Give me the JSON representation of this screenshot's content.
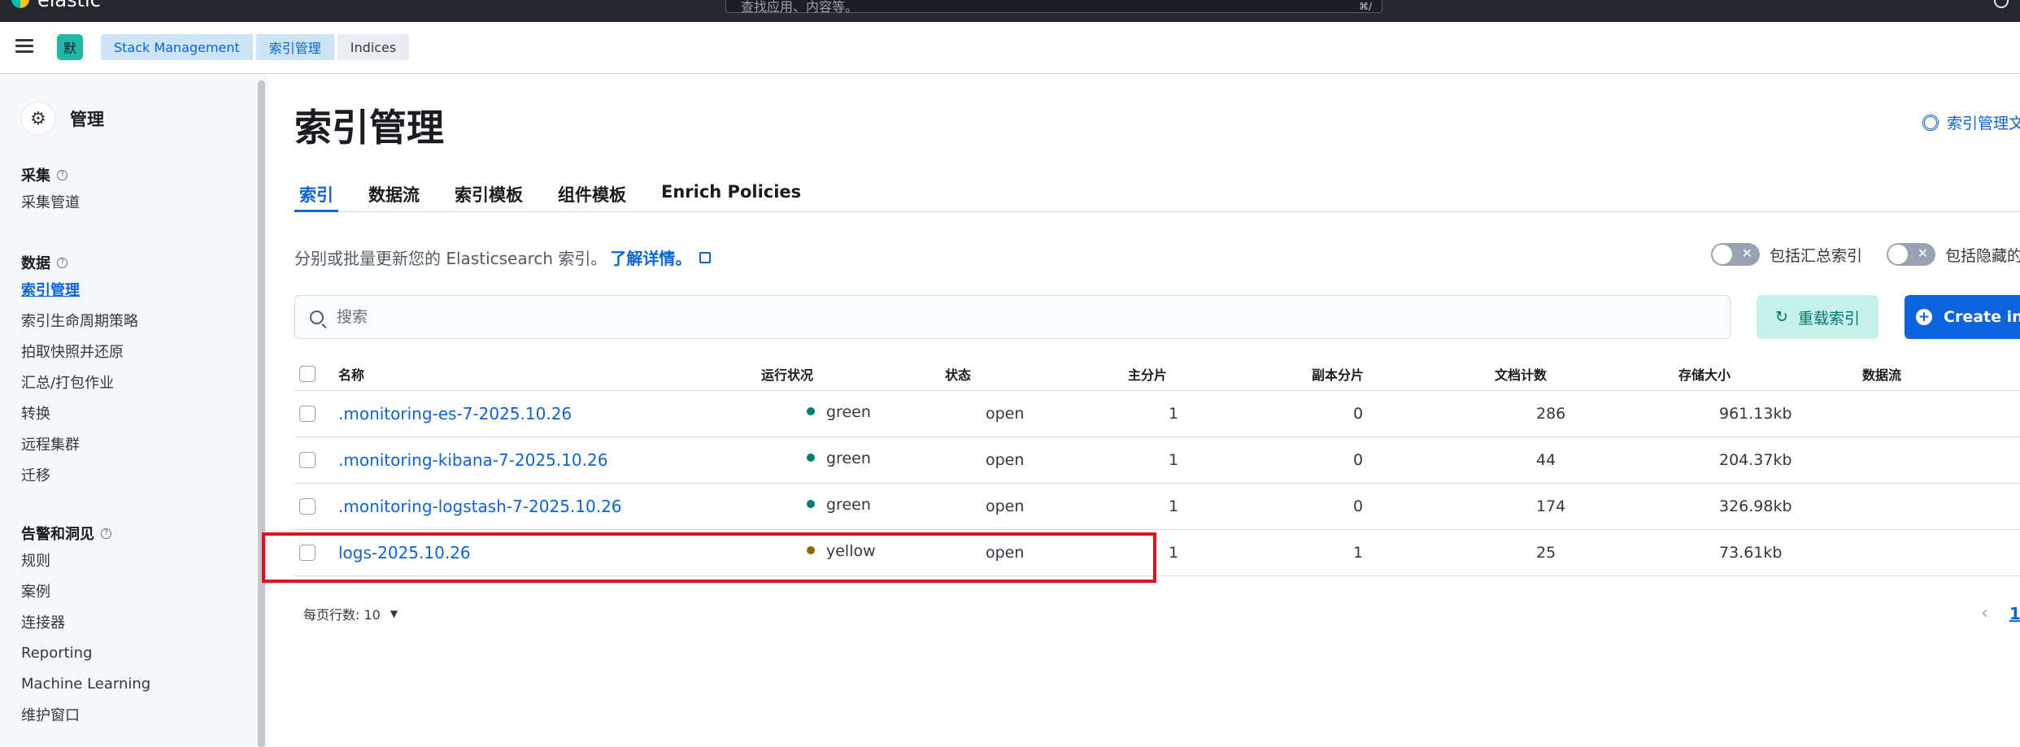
{
  "header": {
    "brand": "elastic",
    "search_placeholder": "查找应用、内容等。",
    "search_shortcut": "⌘/"
  },
  "breadcrumb": {
    "space_initial": "默",
    "items": [
      "Stack Management",
      "索引管理",
      "Indices"
    ]
  },
  "sidebar": {
    "title": "管理",
    "groups": [
      {
        "title": "采集",
        "items": [
          "采集管道"
        ]
      },
      {
        "title": "数据",
        "items": [
          "索引管理",
          "索引生命周期策略",
          "拍取快照并还原",
          "汇总/打包作业",
          "转换",
          "远程集群",
          "迁移"
        ]
      },
      {
        "title": "告警和洞见",
        "items": [
          "规则",
          "案例",
          "连接器",
          "Reporting",
          "Machine Learning",
          "维护窗口"
        ]
      }
    ],
    "active_item": "索引管理"
  },
  "main": {
    "title": "索引管理",
    "doc_link": "索引管理文档",
    "tabs": [
      "索引",
      "数据流",
      "索引模板",
      "组件模板",
      "Enrich Policies"
    ],
    "active_tab": "索引",
    "description": "分别或批量更新您的 Elasticsearch 索引。",
    "learn_more": "了解详情。",
    "toggles": [
      {
        "label": "包括汇总索引",
        "on": false
      },
      {
        "label": "包括隐藏的索引",
        "on": false
      }
    ],
    "search_placeholder": "搜索",
    "reload_label": "重载索引",
    "create_label": "Create index"
  },
  "table": {
    "columns": [
      "名称",
      "运行状况",
      "状态",
      "主分片",
      "副本分片",
      "文档计数",
      "存储大小",
      "数据流"
    ],
    "rows": [
      {
        "name": ".monitoring-es-7-2025.10.26",
        "health": "green",
        "status": "open",
        "primary": "1",
        "replica": "0",
        "docs": "286",
        "size": "961.13kb",
        "stream": ""
      },
      {
        "name": ".monitoring-kibana-7-2025.10.26",
        "health": "green",
        "status": "open",
        "primary": "1",
        "replica": "0",
        "docs": "44",
        "size": "204.37kb",
        "stream": ""
      },
      {
        "name": ".monitoring-logstash-7-2025.10.26",
        "health": "green",
        "status": "open",
        "primary": "1",
        "replica": "0",
        "docs": "174",
        "size": "326.98kb",
        "stream": ""
      },
      {
        "name": "logs-2025.10.26",
        "health": "yellow",
        "status": "open",
        "primary": "1",
        "replica": "1",
        "docs": "25",
        "size": "73.61kb",
        "stream": ""
      }
    ],
    "health_colors": {
      "green": "#017d73",
      "yellow": "#8a6a0a"
    }
  },
  "pagination": {
    "rows_per_page": "每页行数: 10",
    "current_page": "1"
  },
  "colors": {
    "accent": "#0b64dd",
    "highlight": "#e1101a"
  }
}
